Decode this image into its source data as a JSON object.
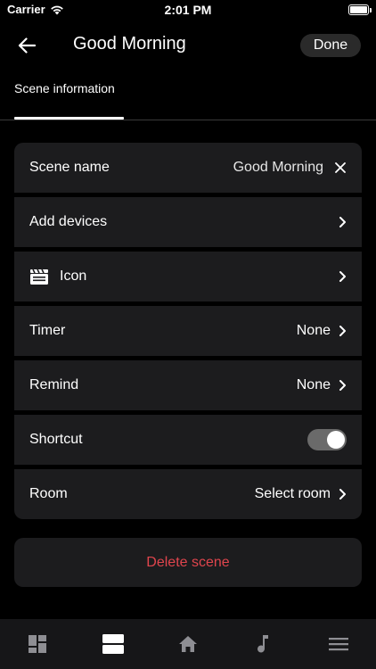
{
  "status_bar": {
    "carrier": "Carrier",
    "time": "2:01 PM"
  },
  "nav": {
    "title": "Good Morning",
    "done_label": "Done"
  },
  "tabs": {
    "scene_info": "Scene information"
  },
  "rows": {
    "scene_name": {
      "label": "Scene name",
      "value": "Good Morning"
    },
    "add_devices": {
      "label": "Add devices"
    },
    "icon": {
      "label": "Icon"
    },
    "timer": {
      "label": "Timer",
      "value": "None"
    },
    "remind": {
      "label": "Remind",
      "value": "None"
    },
    "shortcut": {
      "label": "Shortcut",
      "enabled": true
    },
    "room": {
      "label": "Room",
      "value": "Select room"
    }
  },
  "delete_label": "Delete scene",
  "colors": {
    "background": "#000000",
    "card": "#1c1c1e",
    "danger": "#e0454d",
    "bottom_bar": "#161618"
  },
  "bottom_nav": [
    {
      "icon": "dashboard-icon",
      "active": false
    },
    {
      "icon": "scenes-icon",
      "active": true
    },
    {
      "icon": "home-icon",
      "active": false
    },
    {
      "icon": "music-icon",
      "active": false
    },
    {
      "icon": "menu-icon",
      "active": false
    }
  ]
}
